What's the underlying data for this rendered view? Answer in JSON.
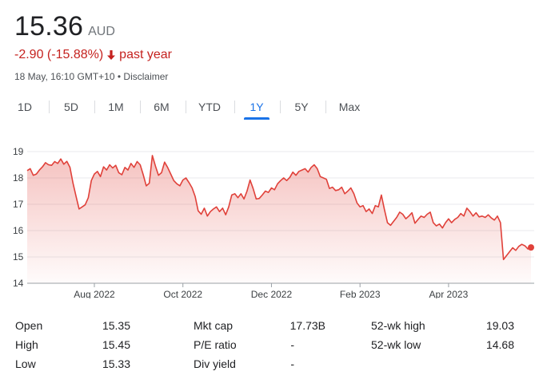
{
  "quote": {
    "price": "15.36",
    "currency": "AUD",
    "change": "-2.90 (-15.88%)",
    "change_period": "past year",
    "timestamp": "18 May, 16:10 GMT+10",
    "separator": "•",
    "disclaimer": "Disclaimer"
  },
  "colors": {
    "line": "#e0413a",
    "negative": "#c5221f",
    "accent": "#1a73e8",
    "grid": "#e8eaed"
  },
  "tabs": [
    {
      "label": "1D"
    },
    {
      "label": "5D"
    },
    {
      "label": "1M"
    },
    {
      "label": "6M"
    },
    {
      "label": "YTD"
    },
    {
      "label": "1Y",
      "active": true
    },
    {
      "label": "5Y"
    },
    {
      "label": "Max"
    }
  ],
  "chart_data": {
    "type": "area",
    "ylim": [
      14,
      19
    ],
    "yticks": [
      "14",
      "15",
      "16",
      "17",
      "18",
      "19"
    ],
    "xticks": [
      "Aug 2022",
      "Oct 2022",
      "Dec 2022",
      "Feb 2023",
      "Apr 2023"
    ],
    "xtick_index": [
      22,
      51,
      80,
      109,
      138
    ],
    "values": [
      18.28,
      18.35,
      18.1,
      18.15,
      18.3,
      18.42,
      18.58,
      18.5,
      18.48,
      18.62,
      18.55,
      18.72,
      18.52,
      18.63,
      18.4,
      17.8,
      17.3,
      16.82,
      16.9,
      16.98,
      17.25,
      17.9,
      18.15,
      18.25,
      18.05,
      18.42,
      18.3,
      18.5,
      18.38,
      18.48,
      18.2,
      18.12,
      18.4,
      18.3,
      18.55,
      18.4,
      18.62,
      18.5,
      18.12,
      17.7,
      17.8,
      18.85,
      18.45,
      18.1,
      18.2,
      18.6,
      18.4,
      18.15,
      17.9,
      17.78,
      17.7,
      17.92,
      18.0,
      17.82,
      17.62,
      17.3,
      16.75,
      16.62,
      16.85,
      16.55,
      16.72,
      16.82,
      16.9,
      16.72,
      16.85,
      16.6,
      16.9,
      17.35,
      17.4,
      17.25,
      17.4,
      17.2,
      17.5,
      17.92,
      17.6,
      17.2,
      17.22,
      17.35,
      17.5,
      17.45,
      17.62,
      17.55,
      17.78,
      17.9,
      18.0,
      17.9,
      18.02,
      18.22,
      18.1,
      18.25,
      18.3,
      18.35,
      18.22,
      18.4,
      18.5,
      18.35,
      18.05,
      18.0,
      17.95,
      17.6,
      17.65,
      17.52,
      17.55,
      17.65,
      17.4,
      17.5,
      17.62,
      17.4,
      17.05,
      16.9,
      16.95,
      16.72,
      16.82,
      16.65,
      16.95,
      16.9,
      17.35,
      16.8,
      16.3,
      16.2,
      16.35,
      16.5,
      16.7,
      16.62,
      16.45,
      16.55,
      16.68,
      16.28,
      16.42,
      16.55,
      16.5,
      16.62,
      16.7,
      16.3,
      16.18,
      16.25,
      16.1,
      16.3,
      16.45,
      16.3,
      16.42,
      16.5,
      16.65,
      16.55,
      16.85,
      16.72,
      16.55,
      16.68,
      16.52,
      16.55,
      16.5,
      16.6,
      16.48,
      16.4,
      16.55,
      16.3,
      14.9,
      15.05,
      15.2,
      15.35,
      15.25,
      15.4,
      15.48,
      15.42,
      15.3,
      15.36
    ]
  },
  "stats": [
    [
      {
        "label": "Open",
        "value": "15.35"
      },
      {
        "label": "High",
        "value": "15.45"
      },
      {
        "label": "Low",
        "value": "15.33"
      }
    ],
    [
      {
        "label": "Mkt cap",
        "value": "17.73B"
      },
      {
        "label": "P/E ratio",
        "value": "-"
      },
      {
        "label": "Div yield",
        "value": "-"
      }
    ],
    [
      {
        "label": "52-wk high",
        "value": "19.03"
      },
      {
        "label": "52-wk low",
        "value": "14.68"
      }
    ]
  ]
}
